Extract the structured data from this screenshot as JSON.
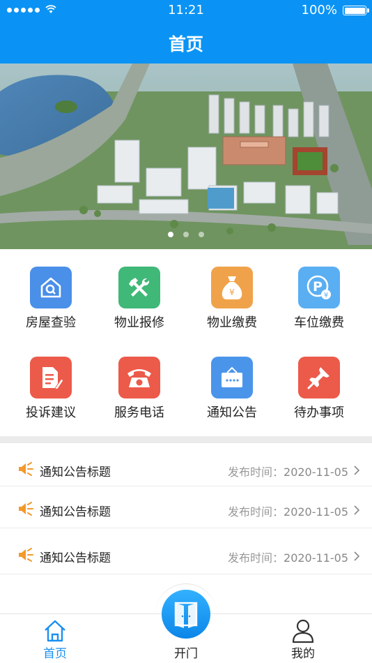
{
  "status_bar": {
    "time": "11:21",
    "battery": "100%"
  },
  "header": {
    "title": "首页"
  },
  "banner": {
    "dots": 3,
    "active_dot": 0
  },
  "menu": [
    {
      "label": "房屋查验",
      "icon": "house-search-icon",
      "color": "#4a8fe8"
    },
    {
      "label": "物业报修",
      "icon": "tools-icon",
      "color": "#3fb878"
    },
    {
      "label": "物业缴费",
      "icon": "money-bag-icon",
      "color": "#f0a24a"
    },
    {
      "label": "车位缴费",
      "icon": "parking-icon",
      "color": "#5aaef2"
    },
    {
      "label": "投诉建议",
      "icon": "document-edit-icon",
      "color": "#ec5a4a"
    },
    {
      "label": "服务电话",
      "icon": "phone-icon",
      "color": "#ec5a4a"
    },
    {
      "label": "通知公告",
      "icon": "notice-board-icon",
      "color": "#4a95ea"
    },
    {
      "label": "待办事项",
      "icon": "pin-icon",
      "color": "#ec5a4a"
    }
  ],
  "notices": [
    {
      "title": "通知公告标题",
      "date_label": "发布时间：",
      "date": "2020-11-05"
    },
    {
      "title": "通知公告标题",
      "date_label": "发布时间：",
      "date": "2020-11-05"
    },
    {
      "title": "通知公告标题",
      "date_label": "发布时间：",
      "date": "2020-11-05"
    }
  ],
  "tabbar": {
    "home": "首页",
    "open_door": "开门",
    "mine": "我的"
  },
  "colors": {
    "primary": "#0a93f5",
    "tab_active": "#1a8ff2",
    "speaker": "#f39a2b"
  }
}
